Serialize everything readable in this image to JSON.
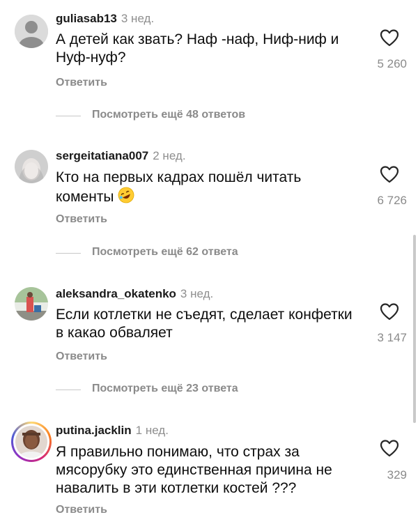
{
  "comments": [
    {
      "username": "guliasab13",
      "time": "3 нед.",
      "text": "А детей как звать? Наф -наф, Ниф-ниф и Нуф-нуф?",
      "likes": "5 260",
      "reply_label": "Ответить",
      "view_more": "Посмотреть ещё 48 ответов"
    },
    {
      "username": "sergeitatiana007",
      "time": "2 нед.",
      "text": "Кто на первых кадрах пошёл читать коменты",
      "emoji": "rolling-on-floor-laughing",
      "likes": "6 726",
      "reply_label": "Ответить",
      "view_more": "Посмотреть ещё 62 ответа"
    },
    {
      "username": "aleksandra_okatenko",
      "time": "3 нед.",
      "text": "Если котлетки не съедят, сделает конфетки в какао обваляет",
      "likes": "3 147",
      "reply_label": "Ответить",
      "view_more": "Посмотреть ещё 23 ответа"
    },
    {
      "username": "putina.jacklin",
      "time": "1 нед.",
      "text": "Я правильно понимаю, что страх за мясорубку это единственная причина не навалить в эти котлетки костей ???",
      "likes": "329",
      "reply_label": "Ответить"
    }
  ],
  "icons": {
    "like": "heart-outline-icon",
    "avatar_default": "default-avatar-icon"
  },
  "colors": {
    "secondary_text": "#8a8a8a",
    "divider": "#c8c8c8"
  }
}
